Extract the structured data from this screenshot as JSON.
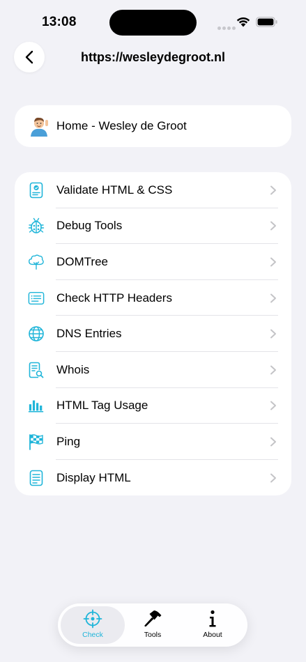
{
  "status_bar": {
    "time": "13:08"
  },
  "nav": {
    "title": "https://wesleydegroot.nl"
  },
  "page_card": {
    "title": "Home - Wesley de Groot"
  },
  "tools": [
    {
      "label": "Validate HTML & CSS",
      "icon": "certificate-icon"
    },
    {
      "label": "Debug Tools",
      "icon": "ladybug-icon"
    },
    {
      "label": "DOMTree",
      "icon": "tree-icon"
    },
    {
      "label": "Check HTTP Headers",
      "icon": "list-window-icon"
    },
    {
      "label": "DNS Entries",
      "icon": "globe-icon"
    },
    {
      "label": "Whois",
      "icon": "doc-magnifier-icon"
    },
    {
      "label": "HTML Tag Usage",
      "icon": "chart-bar-icon"
    },
    {
      "label": "Ping",
      "icon": "flag-checkered-icon"
    },
    {
      "label": "Display HTML",
      "icon": "doc-text-icon"
    }
  ],
  "tab_bar": {
    "tabs": [
      {
        "label": "Check",
        "icon": "scope-icon",
        "active": true
      },
      {
        "label": "Tools",
        "icon": "hammer-icon",
        "active": false
      },
      {
        "label": "About",
        "icon": "info-icon",
        "active": false
      }
    ]
  },
  "colors": {
    "accent": "#1fb5d9",
    "background": "#f2f2f7",
    "chevron": "#c4c4c7"
  }
}
